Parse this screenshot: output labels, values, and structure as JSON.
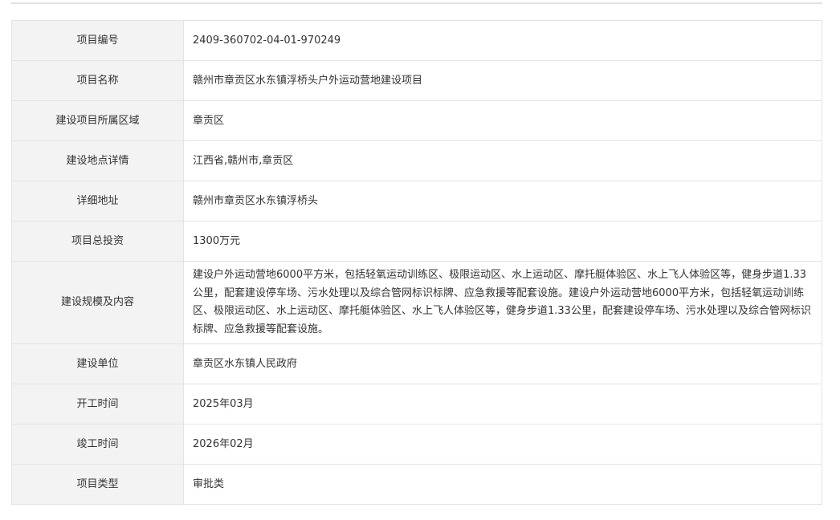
{
  "rows": [
    {
      "label": "项目编号",
      "value": "2409-360702-04-01-970249"
    },
    {
      "label": "项目名称",
      "value": "赣州市章贡区水东镇浮桥头户外运动营地建设项目"
    },
    {
      "label": "建设项目所属区域",
      "value": "章贡区"
    },
    {
      "label": "建设地点详情",
      "value": "江西省,赣州市,章贡区"
    },
    {
      "label": "详细地址",
      "value": "赣州市章贡区水东镇浮桥头"
    },
    {
      "label": "项目总投资",
      "value": "1300万元"
    },
    {
      "label": "建设规模及内容",
      "value": "建设户外运动营地6000平方米，包括轻氧运动训练区、极限运动区、水上运动区、摩托艇体验区、水上飞人体验区等，健身步道1.33公里，配套建设停车场、污水处理以及综合管网标识标牌、应急救援等配套设施。建设户外运动营地6000平方米，包括轻氧运动训练区、极限运动区、水上运动区、摩托艇体验区、水上飞人体验区等，健身步道1.33公里，配套建设停车场、污水处理以及综合管网标识标牌、应急救援等配套设施。"
    },
    {
      "label": "建设单位",
      "value": "章贡区水东镇人民政府"
    },
    {
      "label": "开工时间",
      "value": "2025年03月"
    },
    {
      "label": "竣工时间",
      "value": "2026年02月"
    },
    {
      "label": "项目类型",
      "value": "审批类"
    }
  ]
}
